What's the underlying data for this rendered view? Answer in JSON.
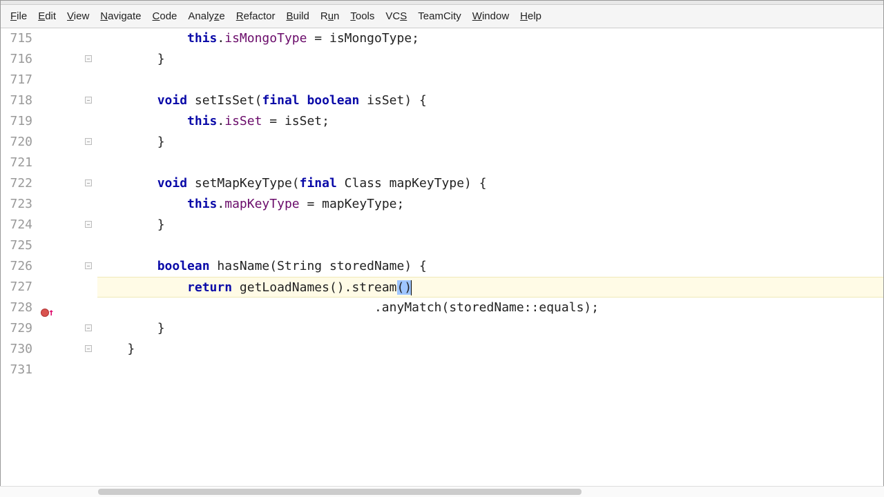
{
  "menu": {
    "file": "File",
    "edit": "Edit",
    "view": "View",
    "navigate": "Navigate",
    "code": "Code",
    "analyze": "Analyze",
    "refactor": "Refactor",
    "build": "Build",
    "run": "Run",
    "tools": "Tools",
    "vcs": "VCS",
    "teamcity": "TeamCity",
    "window": "Window",
    "help": "Help"
  },
  "lines": {
    "n715": "715",
    "n716": "716",
    "n717": "717",
    "n718": "718",
    "n719": "719",
    "n720": "720",
    "n721": "721",
    "n722": "722",
    "n723": "723",
    "n724": "724",
    "n725": "725",
    "n726": "726",
    "n727": "727",
    "n728": "728",
    "n729": "729",
    "n730": "730",
    "n731": "731"
  },
  "code": {
    "l715a": "            ",
    "l715b": "this",
    "l715c": ".",
    "l715d": "isMongoType",
    "l715e": " = isMongoType;",
    "l716": "        }",
    "l717": "",
    "l718a": "        ",
    "l718b": "void",
    "l718c": " setIsSet(",
    "l718d": "final boolean",
    "l718e": " isSet) {",
    "l719a": "            ",
    "l719b": "this",
    "l719c": ".",
    "l719d": "isSet",
    "l719e": " = isSet;",
    "l720": "        }",
    "l721": "",
    "l722a": "        ",
    "l722b": "void",
    "l722c": " setMapKeyType(",
    "l722d": "final",
    "l722e": " Class mapKeyType) {",
    "l723a": "            ",
    "l723b": "this",
    "l723c": ".",
    "l723d": "mapKeyType",
    "l723e": " = mapKeyType;",
    "l724": "        }",
    "l725": "",
    "l726a": "        ",
    "l726b": "boolean",
    "l726c": " hasName(String storedName) {",
    "l727a": "            ",
    "l727b": "return",
    "l727c": " getLoadNames().stream",
    "l727_lp": "(",
    "l727_rp": ")",
    "l728": "                                     .anyMatch(storedName::equals);",
    "l729": "        }",
    "l730": "    }",
    "l731": ""
  },
  "current_line": 727,
  "icons": {
    "error_up": "error-override-icon"
  }
}
